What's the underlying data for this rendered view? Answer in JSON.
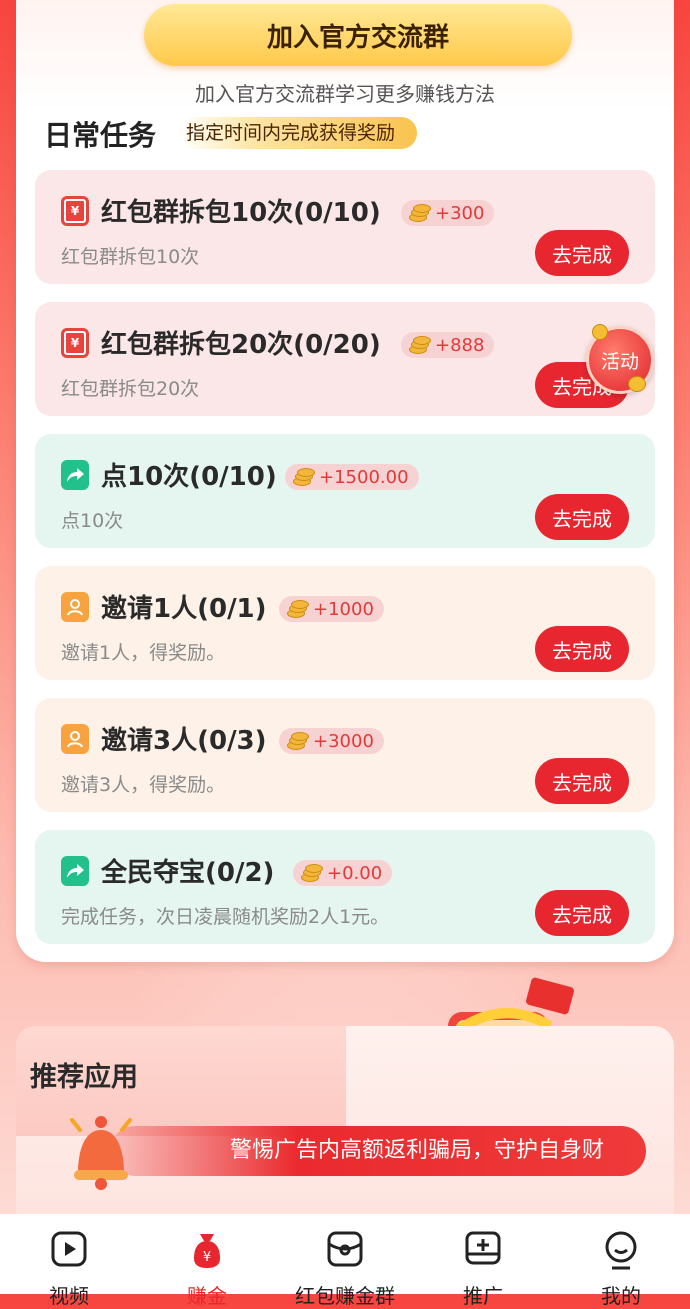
{
  "header": {
    "join_button": "加入官方交流群",
    "join_subtitle": "加入官方交流群学习更多赚钱方法"
  },
  "daily": {
    "title": "日常任务",
    "tag": "指定时间内完成获得奖励"
  },
  "tasks": [
    {
      "title": "红包群拆包10次(0/10)",
      "reward": "+300",
      "subtitle": "红包群拆包10次",
      "button": "去完成",
      "icon": "red-packet-icon"
    },
    {
      "title": "红包群拆包20次(0/20)",
      "reward": "+888",
      "subtitle": "红包群拆包20次",
      "button": "去完成",
      "icon": "red-packet-icon"
    },
    {
      "title": "点10次(0/10)",
      "reward": "+1500.00",
      "subtitle": "点10次",
      "button": "去完成",
      "icon": "share-arrow-icon"
    },
    {
      "title": "邀请1人(0/1)",
      "reward": "+1000",
      "subtitle": "邀请1人，得奖励。",
      "button": "去完成",
      "icon": "user-icon"
    },
    {
      "title": "邀请3人(0/3)",
      "reward": "+3000",
      "subtitle": "邀请3人，得奖励。",
      "button": "去完成",
      "icon": "user-icon"
    },
    {
      "title": "全民夺宝(0/2)",
      "reward": "+0.00",
      "subtitle": "完成任务，次日凌晨随机奖励2人1元。",
      "button": "去完成",
      "icon": "share-arrow-icon"
    }
  ],
  "activity_badge": "活动",
  "recommend": {
    "title": "推荐应用",
    "banner": "警惕广告内高额返利骗局，守护自身财"
  },
  "tabbar": [
    {
      "label": "视频",
      "icon": "play-icon"
    },
    {
      "label": "赚金",
      "icon": "money-bag-icon",
      "active": true
    },
    {
      "label": "红包赚金群",
      "icon": "red-packet-group-icon"
    },
    {
      "label": "推广",
      "icon": "promote-icon"
    },
    {
      "label": "我的",
      "icon": "profile-icon"
    }
  ],
  "colors": {
    "accent": "#e8262f",
    "gold": "#ffc94a",
    "green": "#22c08a"
  }
}
